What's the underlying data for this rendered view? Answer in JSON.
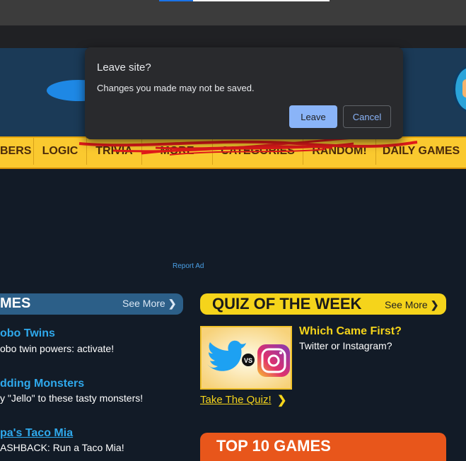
{
  "dialog": {
    "title": "Leave site?",
    "message": "Changes you made may not be saved.",
    "leave_label": "Leave",
    "cancel_label": "Cancel"
  },
  "nav": {
    "items": [
      "BERS",
      "LOGIC",
      "TRIVIA",
      "MORE",
      "CATEGORIES",
      "RANDOM!",
      "DAILY GAMES"
    ]
  },
  "ad": {
    "report_label": "Report Ad"
  },
  "games": {
    "title": "MES",
    "see_more": "See More",
    "items": [
      {
        "title": "obo Twins",
        "desc": "obo twin powers: activate!"
      },
      {
        "title": "dding Monsters",
        "desc": "y \"Jello\" to these tasty monsters!"
      },
      {
        "title": "pa's Taco Mia",
        "desc": "ASHBACK: Run a Taco Mia!"
      }
    ]
  },
  "quiz": {
    "title": "QUIZ OF THE WEEK",
    "see_more": "See More",
    "question": "Which Came First?",
    "subtitle": "Twitter or Instagram?",
    "vs_label": "VS",
    "take_quiz": "Take The Quiz!"
  },
  "top10": {
    "title": "TOP 10 GAMES"
  },
  "colors": {
    "dialog_bg": "#292a2d",
    "accent_blue": "#8ab4f8",
    "nav_yellow": "#fac92f",
    "quiz_yellow": "#f5d41b",
    "top10_orange": "#e8561b",
    "game_link_blue": "#2fa9ec"
  }
}
